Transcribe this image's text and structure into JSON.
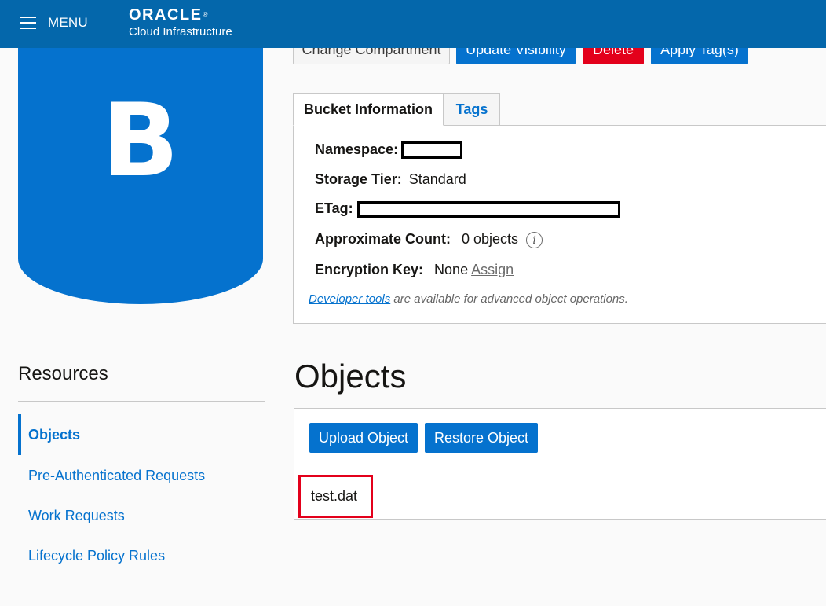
{
  "header": {
    "menu_label": "MENU",
    "brand_name": "ORACLE",
    "brand_mark": "®",
    "brand_sub": "Cloud Infrastructure"
  },
  "bucket": {
    "badge_letter": "B"
  },
  "actions": {
    "change_compartment": "Change Compartment",
    "update_visibility": "Update Visibility",
    "delete": "Delete",
    "apply_tags": "Apply Tag(s)"
  },
  "tabs": [
    {
      "label": "Bucket Information",
      "active": true
    },
    {
      "label": "Tags",
      "active": false
    }
  ],
  "info": {
    "namespace_label": "Namespace:",
    "storage_tier_label": "Storage Tier:",
    "storage_tier_value": "Standard",
    "etag_label": "ETag:",
    "approx_count_label": "Approximate Count:",
    "approx_count_value": "0 objects",
    "info_icon_glyph": "i",
    "encryption_label": "Encryption Key:",
    "encryption_value": "None",
    "encryption_link": "Assign",
    "dev_tools_link": "Developer tools",
    "dev_tools_text": "are available for advanced object operations."
  },
  "resources": {
    "heading": "Resources",
    "items": [
      {
        "label": "Objects",
        "active": true
      },
      {
        "label": "Pre-Authenticated Requests",
        "active": false
      },
      {
        "label": "Work Requests",
        "active": false
      },
      {
        "label": "Lifecycle Policy Rules",
        "active": false
      }
    ]
  },
  "objects": {
    "title": "Objects",
    "upload_button": "Upload Object",
    "restore_button": "Restore Object",
    "items": [
      {
        "name": "test.dat"
      }
    ]
  },
  "colors": {
    "header_bg": "#0467ab",
    "accent": "#0572ce",
    "danger": "#e3001b",
    "highlight_box": "#e3001b"
  }
}
